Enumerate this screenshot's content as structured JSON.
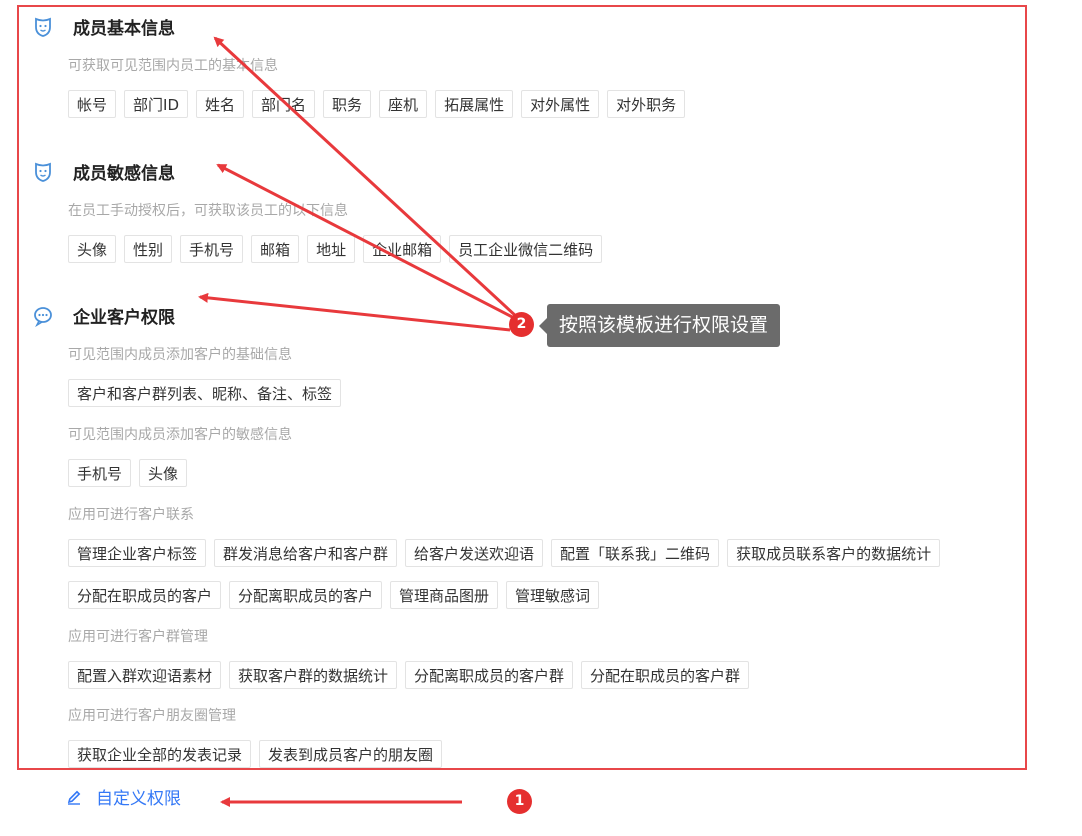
{
  "sections": [
    {
      "title": "成员基本信息",
      "icon": "mask-icon",
      "groups": [
        {
          "subtitle": "可获取可见范围内员工的基本信息",
          "rows": [
            [
              "帐号",
              "部门ID",
              "姓名",
              "部门名",
              "职务",
              "座机",
              "拓展属性",
              "对外属性",
              "对外职务"
            ]
          ]
        }
      ]
    },
    {
      "title": "成员敏感信息",
      "icon": "mask-icon",
      "groups": [
        {
          "subtitle": "在员工手动授权后，可获取该员工的以下信息",
          "rows": [
            [
              "头像",
              "性别",
              "手机号",
              "邮箱",
              "地址",
              "企业邮箱",
              "员工企业微信二维码"
            ]
          ]
        }
      ]
    },
    {
      "title": "企业客户权限",
      "icon": "chat-bubble-icon",
      "groups": [
        {
          "subtitle": "可见范围内成员添加客户的基础信息",
          "rows": [
            [
              "客户和客户群列表、昵称、备注、标签"
            ]
          ]
        },
        {
          "subtitle": "可见范围内成员添加客户的敏感信息",
          "rows": [
            [
              "手机号",
              "头像"
            ]
          ]
        },
        {
          "subtitle": "应用可进行客户联系",
          "rows": [
            [
              "管理企业客户标签",
              "群发消息给客户和客户群",
              "给客户发送欢迎语",
              "配置「联系我」二维码",
              "获取成员联系客户的数据统计"
            ],
            [
              "分配在职成员的客户",
              "分配离职成员的客户",
              "管理商品图册",
              "管理敏感词"
            ]
          ]
        },
        {
          "subtitle": "应用可进行客户群管理",
          "rows": [
            [
              "配置入群欢迎语素材",
              "获取客户群的数据统计",
              "分配离职成员的客户群",
              "分配在职成员的客户群"
            ]
          ]
        },
        {
          "subtitle": "应用可进行客户朋友圈管理",
          "rows": [
            [
              "获取企业全部的发表记录",
              "发表到成员客户的朋友圈"
            ]
          ]
        }
      ]
    }
  ],
  "custom_link": {
    "label": "自定义权限",
    "icon": "pencil-icon"
  },
  "annotations": {
    "badge_1": "1",
    "badge_2": "2",
    "tooltip": "按照该模板进行权限设置"
  },
  "colors": {
    "frame": "#e8474a",
    "link": "#3478f6",
    "icon": "#4a90d9",
    "tooltip_bg": "#6b6b6b",
    "badge": "#e52f2f"
  }
}
